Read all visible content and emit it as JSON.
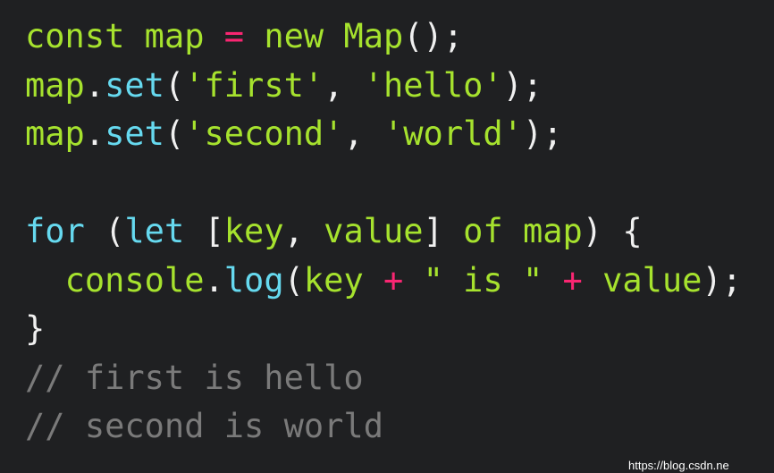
{
  "editor": {
    "background": "#1f2022",
    "colors": {
      "keyword": "#a6e22e",
      "function": "#66d9ef",
      "operator": "#f92672",
      "string": "#a6e22e",
      "identifier": "#a6e22e",
      "punctuation": "#f0f0f0",
      "comment": "#7a7a7a"
    },
    "lines": [
      {
        "tokens": [
          {
            "t": "kw",
            "v": "const"
          },
          {
            "t": "plain",
            "v": " "
          },
          {
            "t": "id",
            "v": "map"
          },
          {
            "t": "plain",
            "v": " "
          },
          {
            "t": "op",
            "v": "="
          },
          {
            "t": "plain",
            "v": " "
          },
          {
            "t": "kw",
            "v": "new"
          },
          {
            "t": "plain",
            "v": " "
          },
          {
            "t": "id",
            "v": "Map"
          },
          {
            "t": "punc",
            "v": "();"
          }
        ]
      },
      {
        "tokens": [
          {
            "t": "id",
            "v": "map"
          },
          {
            "t": "punc",
            "v": "."
          },
          {
            "t": "fn",
            "v": "set"
          },
          {
            "t": "punc",
            "v": "("
          },
          {
            "t": "str",
            "v": "'first'"
          },
          {
            "t": "punc",
            "v": ", "
          },
          {
            "t": "str",
            "v": "'hello'"
          },
          {
            "t": "punc",
            "v": ");"
          }
        ]
      },
      {
        "tokens": [
          {
            "t": "id",
            "v": "map"
          },
          {
            "t": "punc",
            "v": "."
          },
          {
            "t": "fn",
            "v": "set"
          },
          {
            "t": "punc",
            "v": "("
          },
          {
            "t": "str",
            "v": "'second'"
          },
          {
            "t": "punc",
            "v": ", "
          },
          {
            "t": "str",
            "v": "'world'"
          },
          {
            "t": "punc",
            "v": ");"
          }
        ]
      },
      {
        "tokens": []
      },
      {
        "tokens": [
          {
            "t": "fn",
            "v": "for"
          },
          {
            "t": "plain",
            "v": " "
          },
          {
            "t": "punc",
            "v": "("
          },
          {
            "t": "fn",
            "v": "let"
          },
          {
            "t": "plain",
            "v": " "
          },
          {
            "t": "punc",
            "v": "["
          },
          {
            "t": "id",
            "v": "key"
          },
          {
            "t": "punc",
            "v": ", "
          },
          {
            "t": "id",
            "v": "value"
          },
          {
            "t": "punc",
            "v": "]"
          },
          {
            "t": "plain",
            "v": " "
          },
          {
            "t": "id",
            "v": "of"
          },
          {
            "t": "plain",
            "v": " "
          },
          {
            "t": "id",
            "v": "map"
          },
          {
            "t": "punc",
            "v": ") {"
          }
        ]
      },
      {
        "tokens": [
          {
            "t": "plain",
            "v": "  "
          },
          {
            "t": "id",
            "v": "console"
          },
          {
            "t": "punc",
            "v": "."
          },
          {
            "t": "fn",
            "v": "log"
          },
          {
            "t": "punc",
            "v": "("
          },
          {
            "t": "id",
            "v": "key"
          },
          {
            "t": "plain",
            "v": " "
          },
          {
            "t": "op",
            "v": "+"
          },
          {
            "t": "plain",
            "v": " "
          },
          {
            "t": "str",
            "v": "\" is \""
          },
          {
            "t": "plain",
            "v": " "
          },
          {
            "t": "op",
            "v": "+"
          },
          {
            "t": "plain",
            "v": " "
          },
          {
            "t": "id",
            "v": "value"
          },
          {
            "t": "punc",
            "v": ");"
          }
        ]
      },
      {
        "tokens": [
          {
            "t": "punc",
            "v": "}"
          }
        ]
      },
      {
        "tokens": [
          {
            "t": "com",
            "v": "// first is hello"
          }
        ]
      },
      {
        "tokens": [
          {
            "t": "com",
            "v": "// second is world"
          }
        ]
      }
    ]
  },
  "watermark": "https://blog.csdn.ne"
}
